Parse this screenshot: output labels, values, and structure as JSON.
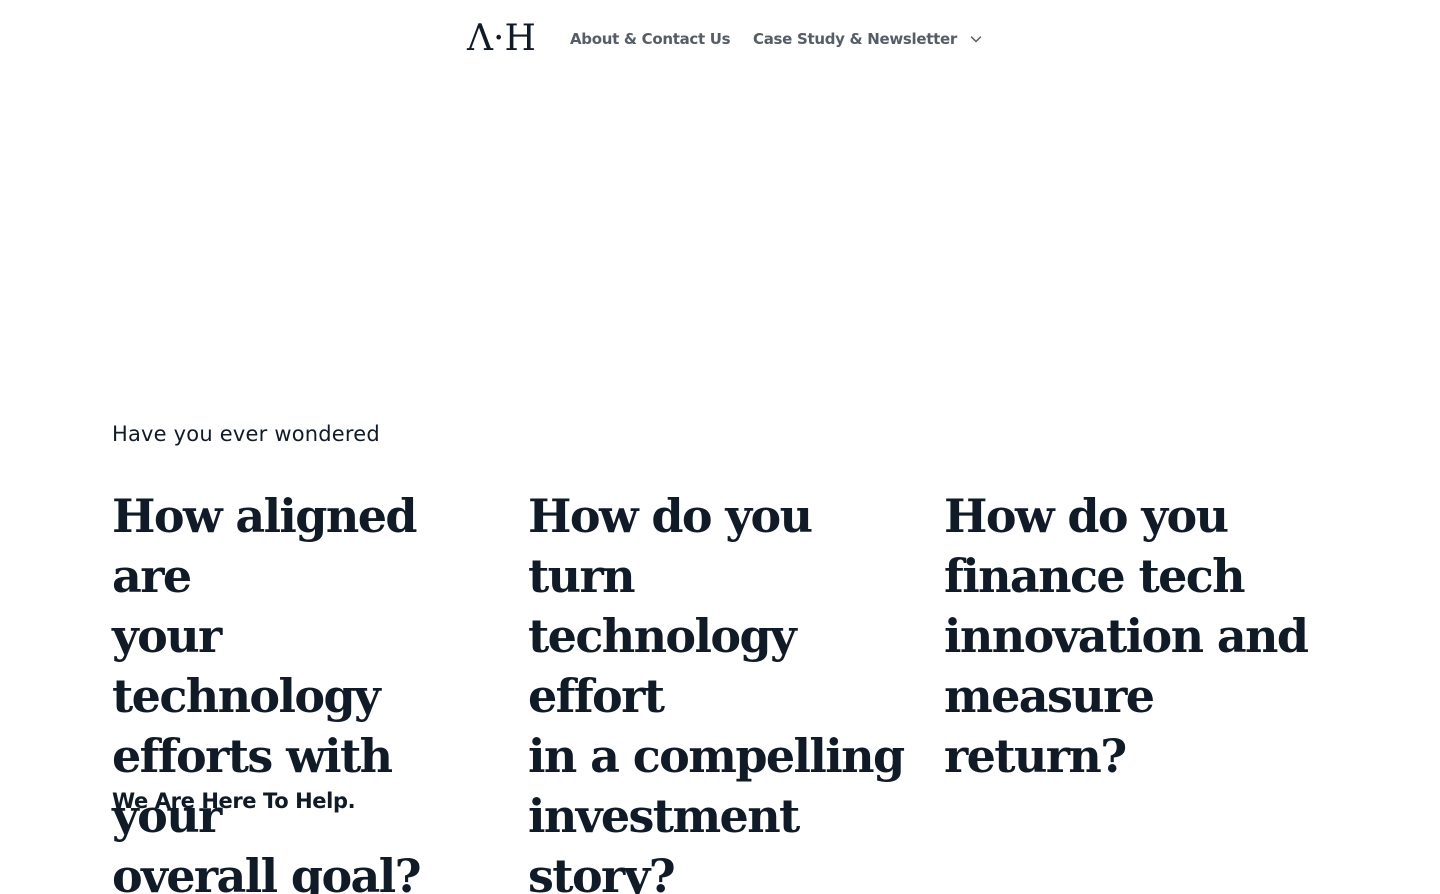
{
  "header": {
    "logo": "Λ·H",
    "nav": {
      "about_label": "About & Contact Us",
      "case_label": "Case Study & Newsletter"
    }
  },
  "hero": {
    "eyebrow": "Have you ever wondered",
    "questions": [
      {
        "line1": "How aligned are",
        "line2": "your technology",
        "line3": "efforts with your",
        "line4": "overall goal?"
      },
      {
        "line1": "How do you turn",
        "line2": "technology effort",
        "line3": "in a compelling",
        "line4": "investment story?"
      },
      {
        "line1": "How do you",
        "line2": "finance tech",
        "line3": "innovation and",
        "line4": "measure return?"
      }
    ],
    "tagline": "We Are Here To Help."
  },
  "icons": {
    "dropdown": "chevron-down-icon"
  },
  "colors": {
    "text": "#111b27",
    "nav_text": "#565d66",
    "background": "#ffffff"
  }
}
